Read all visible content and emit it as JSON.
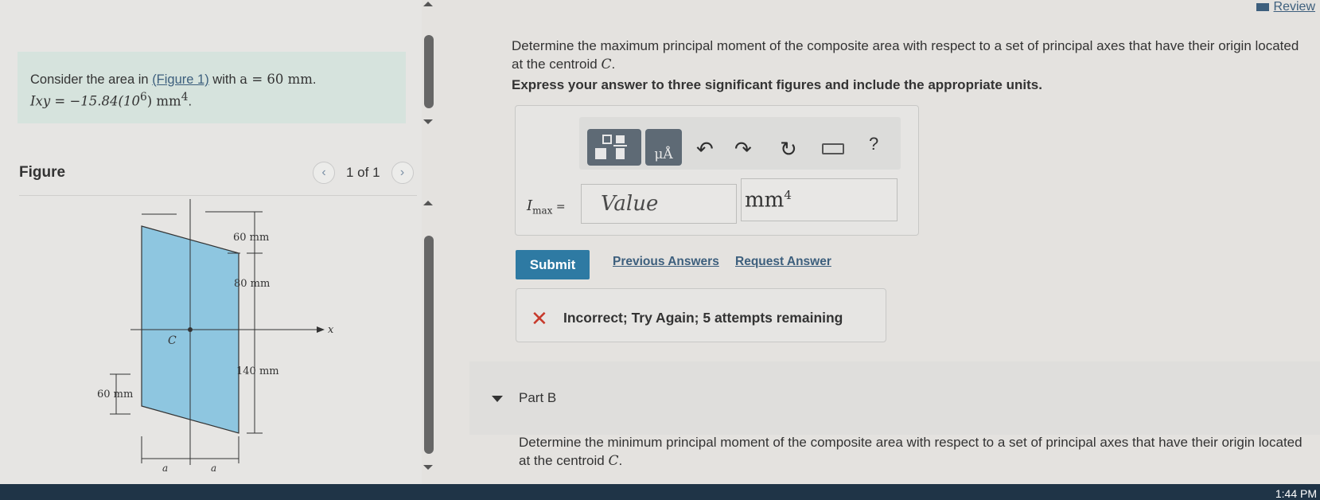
{
  "header": {
    "review_label": "Review"
  },
  "problem": {
    "prefix": "Consider the area in ",
    "figure_link": "(Figure 1)",
    "with": " with ",
    "a_value": "a = 60 mm",
    "ixy_text": "Ixy = −15.84(10",
    "ixy_exp": "6",
    "ixy_unit": ") mm",
    "ixy_unit_exp": "4",
    "period": "."
  },
  "figure": {
    "title": "Figure",
    "pager_text": "1 of 1",
    "labels": {
      "dim_top": "60 mm",
      "dim_mid": "80 mm",
      "dim_low": "140 mm",
      "dim_left": "60 mm",
      "centroid": "C",
      "axis_x": "x",
      "a_left": "a",
      "a_right": "a"
    }
  },
  "part_a": {
    "question": "Determine the maximum principal moment of the composite area with respect to a set of principal axes that have their origin located at the centroid ",
    "centroid_symbol": "C",
    "period": ".",
    "instruction": "Express your answer to three significant figures and include the appropriate units.",
    "toolbar": {
      "help_label": "?",
      "units_label": "μÅ"
    },
    "answer_label_main": "I",
    "answer_label_sub": "max",
    "answer_label_eq": " =",
    "value_placeholder": "Value",
    "unit_value": "mm",
    "unit_exp": "4",
    "submit_label": "Submit",
    "previous_answers_label": "Previous Answers",
    "request_answer_label": "Request Answer",
    "feedback_icon": "✕",
    "feedback_text": "Incorrect; Try Again; 5 attempts remaining"
  },
  "part_b": {
    "title": "Part B",
    "question": "Determine the minimum principal moment of the composite area with respect to a set of principal axes that have their origin located at the centroid ",
    "centroid_symbol": "C",
    "period": "."
  },
  "taskbar": {
    "clock": "1:44 PM"
  },
  "colors": {
    "accent": "#2e7aa3",
    "link": "#3d5f7d",
    "error": "#c7392b",
    "problem_bg": "#d6e3dd",
    "shape_fill": "#8ec6e0"
  }
}
